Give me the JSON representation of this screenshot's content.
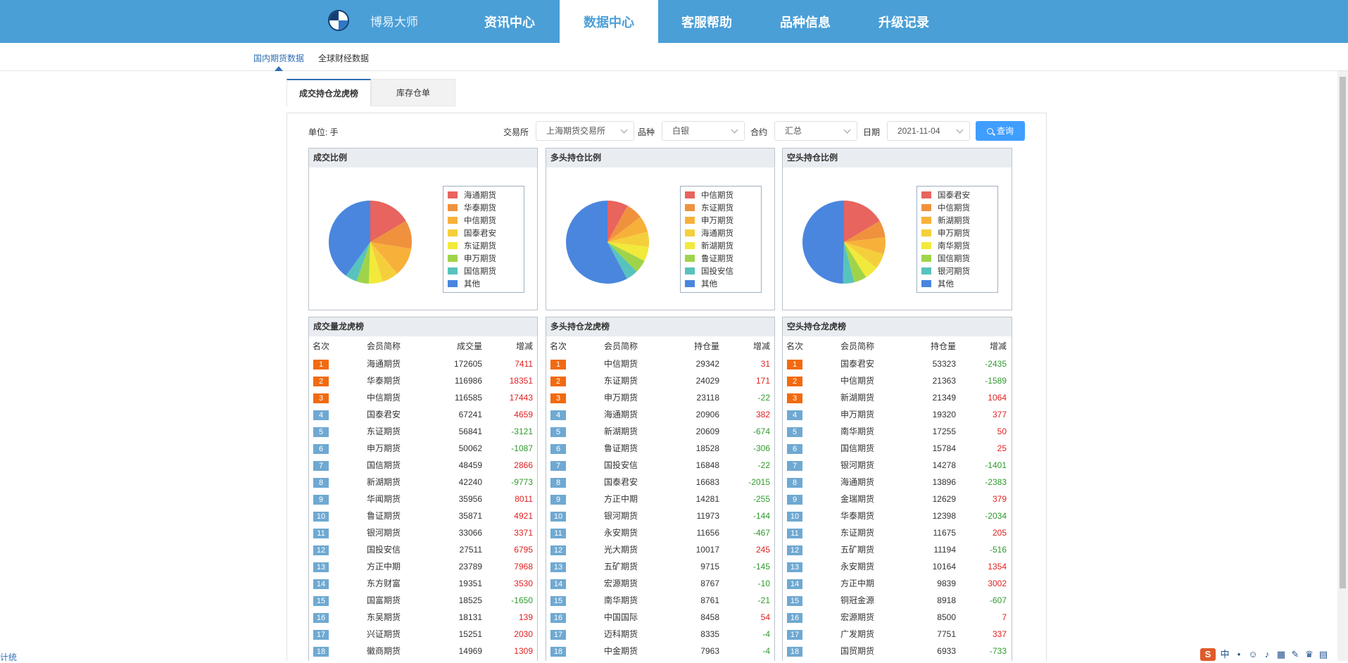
{
  "brand": {
    "name": "博易大师"
  },
  "nav": {
    "tabs": [
      "资讯中心",
      "数据中心",
      "客服帮助",
      "品种信息",
      "升级记录"
    ],
    "active": "数据中心"
  },
  "subnav": {
    "items": [
      "国内期货数据",
      "全球财经数据"
    ],
    "active": "国内期货数据"
  },
  "tabs": {
    "items": [
      "成交持仓龙虎榜",
      "库存仓单"
    ],
    "active": "成交持仓龙虎榜"
  },
  "filters": {
    "unit": "单位: 手",
    "exchange_label": "交易所",
    "exchange_value": "上海期货交易所",
    "variety_label": "品种",
    "variety_value": "白银",
    "contract_label": "合约",
    "contract_value": "汇总",
    "date_label": "日期",
    "date_value": "2021-11-04",
    "query_label": "查询"
  },
  "colors": {
    "slices": [
      "#e8645e",
      "#f0923d",
      "#f7b13a",
      "#f5cf3b",
      "#f2ea3a",
      "#9fd44a",
      "#58c3bd",
      "#4a86de"
    ]
  },
  "pies": [
    {
      "title": "成交比例",
      "legend": [
        "海通期货",
        "华泰期货",
        "中信期货",
        "国泰君安",
        "东证期货",
        "申万期货",
        "国信期货",
        "其他"
      ],
      "values": [
        172605,
        116986,
        116585,
        67241,
        56841,
        50062,
        48459,
        420000
      ]
    },
    {
      "title": "多头持仓比例",
      "legend": [
        "中信期货",
        "东证期货",
        "申万期货",
        "海通期货",
        "新湖期货",
        "鲁证期货",
        "国投安信",
        "其他"
      ],
      "values": [
        29342,
        24029,
        23118,
        20906,
        20609,
        18528,
        16848,
        210000
      ]
    },
    {
      "title": "空头持仓比例",
      "legend": [
        "国泰君安",
        "中信期货",
        "新湖期货",
        "申万期货",
        "南华期货",
        "国信期货",
        "银河期货",
        "其他"
      ],
      "values": [
        53323,
        21363,
        21349,
        19320,
        17255,
        15784,
        14278,
        160000
      ]
    }
  ],
  "tables": [
    {
      "title": "成交量龙虎榜",
      "headers": [
        "名次",
        "会员简称",
        "成交量",
        "增减"
      ],
      "rows": [
        [
          "1",
          "海通期货",
          "172605",
          "7411"
        ],
        [
          "2",
          "华泰期货",
          "116986",
          "18351"
        ],
        [
          "3",
          "中信期货",
          "116585",
          "17443"
        ],
        [
          "4",
          "国泰君安",
          "67241",
          "4659"
        ],
        [
          "5",
          "东证期货",
          "56841",
          "-3121"
        ],
        [
          "6",
          "申万期货",
          "50062",
          "-1087"
        ],
        [
          "7",
          "国信期货",
          "48459",
          "2866"
        ],
        [
          "8",
          "新湖期货",
          "42240",
          "-9773"
        ],
        [
          "9",
          "华闻期货",
          "35956",
          "8011"
        ],
        [
          "10",
          "鲁证期货",
          "35871",
          "4921"
        ],
        [
          "11",
          "银河期货",
          "33066",
          "3371"
        ],
        [
          "12",
          "国投安信",
          "27511",
          "6795"
        ],
        [
          "13",
          "方正中期",
          "23789",
          "7968"
        ],
        [
          "14",
          "东方财富",
          "19351",
          "3530"
        ],
        [
          "15",
          "国富期货",
          "18525",
          "-1650"
        ],
        [
          "16",
          "东吴期货",
          "18131",
          "139"
        ],
        [
          "17",
          "兴证期货",
          "15251",
          "2030"
        ],
        [
          "18",
          "徽商期货",
          "14969",
          "1309"
        ]
      ]
    },
    {
      "title": "多头持仓龙虎榜",
      "headers": [
        "名次",
        "会员简称",
        "持仓量",
        "增减"
      ],
      "rows": [
        [
          "1",
          "中信期货",
          "29342",
          "31"
        ],
        [
          "2",
          "东证期货",
          "24029",
          "171"
        ],
        [
          "3",
          "申万期货",
          "23118",
          "-22"
        ],
        [
          "4",
          "海通期货",
          "20906",
          "382"
        ],
        [
          "5",
          "新湖期货",
          "20609",
          "-674"
        ],
        [
          "6",
          "鲁证期货",
          "18528",
          "-306"
        ],
        [
          "7",
          "国投安信",
          "16848",
          "-22"
        ],
        [
          "8",
          "国泰君安",
          "16683",
          "-2015"
        ],
        [
          "9",
          "方正中期",
          "14281",
          "-255"
        ],
        [
          "10",
          "银河期货",
          "11973",
          "-144"
        ],
        [
          "11",
          "永安期货",
          "11656",
          "-467"
        ],
        [
          "12",
          "光大期货",
          "10017",
          "245"
        ],
        [
          "13",
          "五矿期货",
          "9715",
          "-145"
        ],
        [
          "14",
          "宏源期货",
          "8767",
          "-10"
        ],
        [
          "15",
          "南华期货",
          "8761",
          "-21"
        ],
        [
          "16",
          "中国国际",
          "8458",
          "54"
        ],
        [
          "17",
          "迈科期货",
          "8335",
          "-4"
        ],
        [
          "18",
          "中金期货",
          "7963",
          "-4"
        ]
      ]
    },
    {
      "title": "空头持仓龙虎榜",
      "headers": [
        "名次",
        "会员简称",
        "持仓量",
        "增减"
      ],
      "rows": [
        [
          "1",
          "国泰君安",
          "53323",
          "-2435"
        ],
        [
          "2",
          "中信期货",
          "21363",
          "-1589"
        ],
        [
          "3",
          "新湖期货",
          "21349",
          "1064"
        ],
        [
          "4",
          "申万期货",
          "19320",
          "377"
        ],
        [
          "5",
          "南华期货",
          "17255",
          "50"
        ],
        [
          "6",
          "国信期货",
          "15784",
          "25"
        ],
        [
          "7",
          "银河期货",
          "14278",
          "-1401"
        ],
        [
          "8",
          "海通期货",
          "13896",
          "-2383"
        ],
        [
          "9",
          "金瑞期货",
          "12629",
          "379"
        ],
        [
          "10",
          "华泰期货",
          "12398",
          "-2034"
        ],
        [
          "11",
          "东证期货",
          "11675",
          "205"
        ],
        [
          "12",
          "五矿期货",
          "11194",
          "-516"
        ],
        [
          "13",
          "永安期货",
          "10164",
          "1354"
        ],
        [
          "14",
          "方正中期",
          "9839",
          "3002"
        ],
        [
          "15",
          "铜冠金源",
          "8918",
          "-607"
        ],
        [
          "16",
          "宏源期货",
          "8500",
          "7"
        ],
        [
          "17",
          "广发期货",
          "7751",
          "337"
        ],
        [
          "18",
          "国贸期货",
          "6933",
          "-733"
        ]
      ]
    }
  ],
  "tray": {
    "logo": "S",
    "glyphs": [
      "中",
      "•",
      "☺",
      "♪",
      "▦",
      "✎",
      "♛",
      "▤"
    ]
  },
  "left_edge_text": "计统"
}
